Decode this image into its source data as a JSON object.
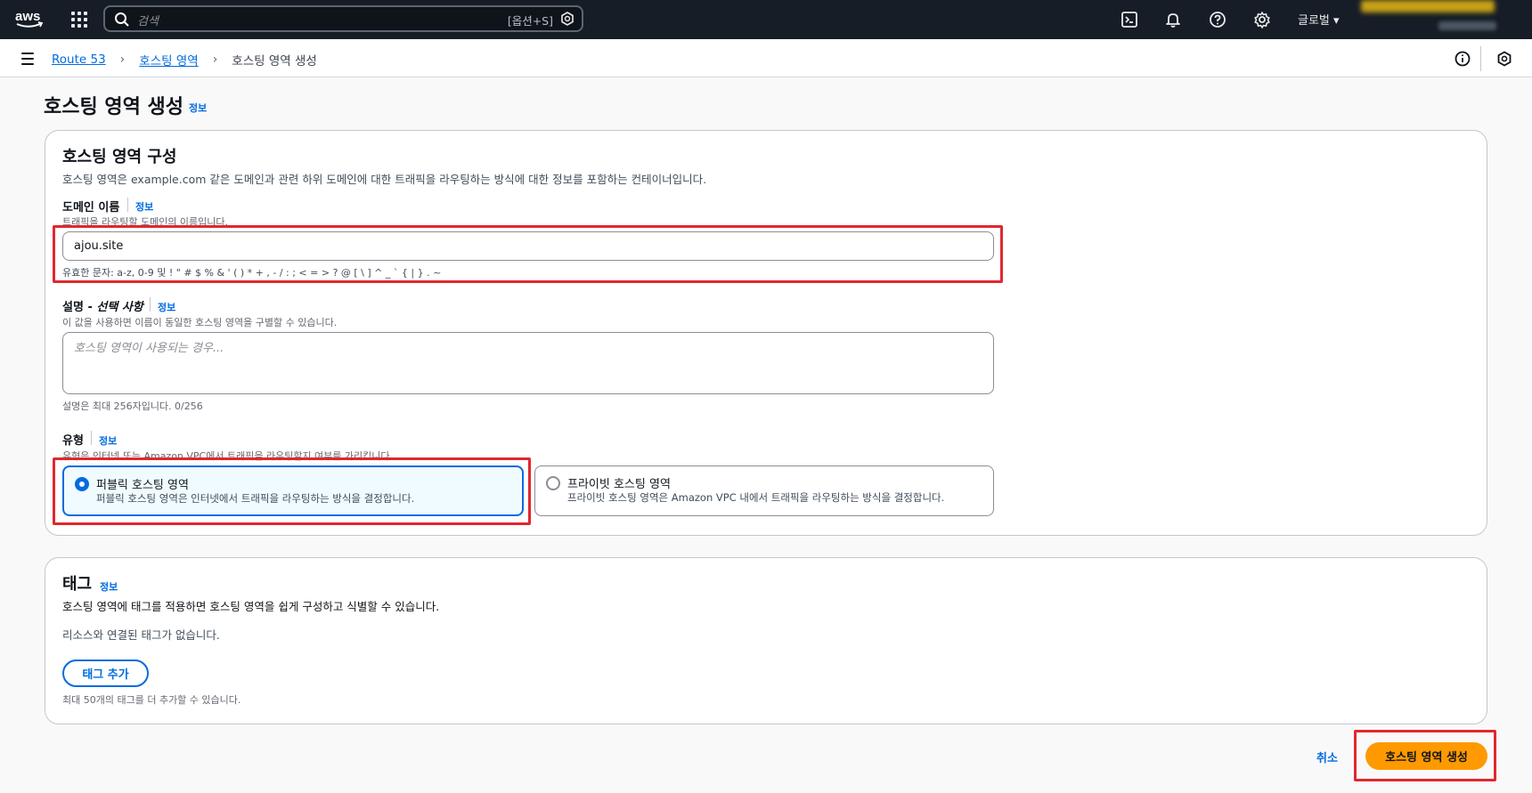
{
  "topnav": {
    "logo_text": "aws",
    "search_placeholder": "검색",
    "search_shortcut": "[옵션+S]",
    "region": "글로벌 ▾"
  },
  "breadcrumb": {
    "items": [
      "Route 53",
      "호스팅 영역",
      "호스팅 영역 생성"
    ]
  },
  "page": {
    "title": "호스팅 영역 생성",
    "title_info": "정보"
  },
  "config": {
    "heading": "호스팅 영역 구성",
    "description": "호스팅 영역은 example.com 같은 도메인과 관련 하위 도메인에 대한 트래픽을 라우팅하는 방식에 대한 정보를 포함하는 컨테이너입니다.",
    "domain": {
      "label": "도메인 이름",
      "info": "정보",
      "hint": "트래픽을 라우팅할 도메인의 이름입니다.",
      "value": "ajou.site",
      "constraint": "유효한 문자: a-z, 0-9 및 ! \" # $ % & ' ( ) * + , - / : ; < = > ? @ [ \\ ] ^ _ ` { | } . ~"
    },
    "description_field": {
      "label": "설명 - ",
      "label_optional": "선택 사항",
      "info": "정보",
      "hint": "이 값을 사용하면 이름이 동일한 호스팅 영역을 구별할 수 있습니다.",
      "placeholder": "호스팅 영역이 사용되는 경우...",
      "constraint": "설명은 최대 256자입니다. 0/256"
    },
    "type": {
      "label": "유형",
      "info": "정보",
      "hint": "유형은 인터넷 또는 Amazon VPC에서 트래픽을 라우팅할지 여부를 가리킵니다.",
      "options": [
        {
          "title": "퍼블릭 호스팅 영역",
          "desc": "퍼블릭 호스팅 영역은 인터넷에서 트래픽을 라우팅하는 방식을 결정합니다.",
          "selected": true
        },
        {
          "title": "프라이빗 호스팅 영역",
          "desc": "프라이빗 호스팅 영역은 Amazon VPC 내에서 트래픽을 라우팅하는 방식을 결정합니다.",
          "selected": false
        }
      ]
    }
  },
  "tags": {
    "heading": "태그",
    "info": "정보",
    "description": "호스팅 영역에 태그를 적용하면 호스팅 영역을 쉽게 구성하고 식별할 수 있습니다.",
    "empty": "리소스와 연결된 태그가 없습니다.",
    "add_button": "태그 추가",
    "limit": "최대 50개의 태그를 더 추가할 수 있습니다."
  },
  "actions": {
    "cancel": "취소",
    "create": "호스팅 영역 생성"
  },
  "colors": {
    "nav_bg": "#161d26",
    "link": "#006ce0",
    "primary": "#ff9900",
    "highlight": "#e0282e"
  }
}
